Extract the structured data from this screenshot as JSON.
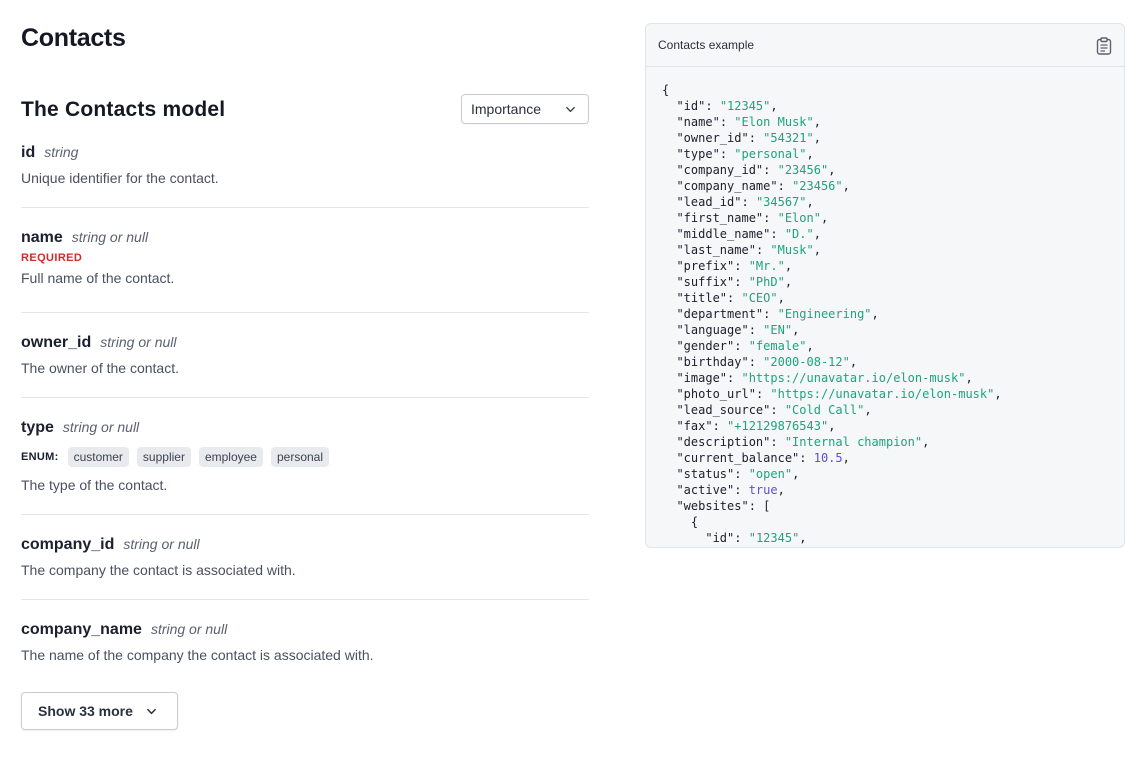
{
  "page": {
    "title": "Contacts"
  },
  "model": {
    "title": "The Contacts model"
  },
  "sort": {
    "selected": "Importance"
  },
  "fields": [
    {
      "name": "id",
      "type": "string",
      "required": false,
      "description": "Unique identifier for the contact."
    },
    {
      "name": "name",
      "type": "string or null",
      "required": true,
      "required_label": "REQUIRED",
      "description": "Full name of the contact."
    },
    {
      "name": "owner_id",
      "type": "string or null",
      "required": false,
      "description": "The owner of the contact."
    },
    {
      "name": "type",
      "type": "string or null",
      "required": false,
      "enum_label": "ENUM:",
      "enum": [
        "customer",
        "supplier",
        "employee",
        "personal"
      ],
      "description": "The type of the contact."
    },
    {
      "name": "company_id",
      "type": "string or null",
      "required": false,
      "description": "The company the contact is associated with."
    },
    {
      "name": "company_name",
      "type": "string or null",
      "required": false,
      "description": "The name of the company the contact is associated with."
    }
  ],
  "show_more": {
    "label": "Show 33 more"
  },
  "example": {
    "title": "Contacts example",
    "open_brace": "{",
    "lines": [
      {
        "key": "id",
        "value": "12345",
        "kind": "str"
      },
      {
        "key": "name",
        "value": "Elon Musk",
        "kind": "str"
      },
      {
        "key": "owner_id",
        "value": "54321",
        "kind": "str"
      },
      {
        "key": "type",
        "value": "personal",
        "kind": "str"
      },
      {
        "key": "company_id",
        "value": "23456",
        "kind": "str"
      },
      {
        "key": "company_name",
        "value": "23456",
        "kind": "str"
      },
      {
        "key": "lead_id",
        "value": "34567",
        "kind": "str"
      },
      {
        "key": "first_name",
        "value": "Elon",
        "kind": "str"
      },
      {
        "key": "middle_name",
        "value": "D.",
        "kind": "str"
      },
      {
        "key": "last_name",
        "value": "Musk",
        "kind": "str"
      },
      {
        "key": "prefix",
        "value": "Mr.",
        "kind": "str"
      },
      {
        "key": "suffix",
        "value": "PhD",
        "kind": "str"
      },
      {
        "key": "title",
        "value": "CEO",
        "kind": "str"
      },
      {
        "key": "department",
        "value": "Engineering",
        "kind": "str"
      },
      {
        "key": "language",
        "value": "EN",
        "kind": "str"
      },
      {
        "key": "gender",
        "value": "female",
        "kind": "str"
      },
      {
        "key": "birthday",
        "value": "2000-08-12",
        "kind": "str"
      },
      {
        "key": "image",
        "value": "https://unavatar.io/elon-musk",
        "kind": "str"
      },
      {
        "key": "photo_url",
        "value": "https://unavatar.io/elon-musk",
        "kind": "str"
      },
      {
        "key": "lead_source",
        "value": "Cold Call",
        "kind": "str"
      },
      {
        "key": "fax",
        "value": "+12129876543",
        "kind": "str"
      },
      {
        "key": "description",
        "value": "Internal champion",
        "kind": "str"
      },
      {
        "key": "current_balance",
        "value": "10.5",
        "kind": "num"
      },
      {
        "key": "status",
        "value": "open",
        "kind": "str"
      },
      {
        "key": "active",
        "value": "true",
        "kind": "bool"
      },
      {
        "key": "websites",
        "value": "[",
        "kind": "open"
      },
      {
        "key": "",
        "value": "{",
        "kind": "brace",
        "indent": 2
      },
      {
        "key": "id",
        "value": "12345",
        "kind": "str",
        "indent": 3
      }
    ]
  }
}
